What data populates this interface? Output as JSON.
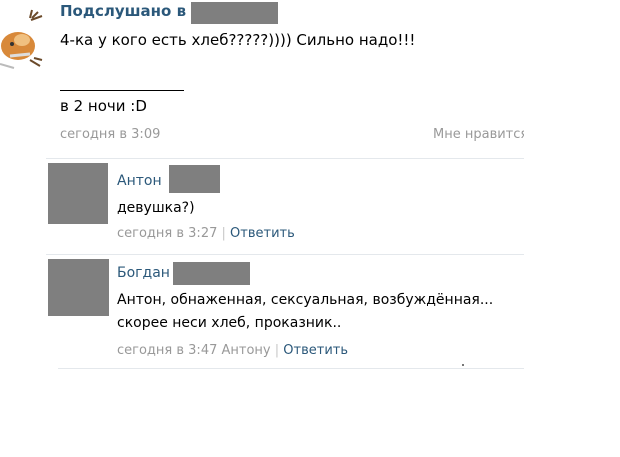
{
  "post": {
    "group_name": "Подслушано в",
    "text": "4-ка у кого есть хлеб?????)))) Сильно надо!!!",
    "text_after_line": "в 2 ночи :D",
    "date": "сегодня в 3:09",
    "like_label": "Мне нравится"
  },
  "comments": [
    {
      "author": "Антон",
      "text_lines": [
        "девушка?)"
      ],
      "date": "сегодня в 3:27",
      "reply_to": "",
      "separator": "|",
      "reply_label": "Ответить"
    },
    {
      "author": "Богдан",
      "text_lines": [
        "Антон, обнаженная, сексуальная, возбуждённая...",
        "скорее неси хлеб, проказник.."
      ],
      "date": "сегодня в 3:47",
      "reply_to": "Антону",
      "separator": "|",
      "reply_label": "Ответить"
    }
  ],
  "colors": {
    "link": "#2b587a",
    "meta": "#999999",
    "redaction": "#7f7f7f"
  }
}
